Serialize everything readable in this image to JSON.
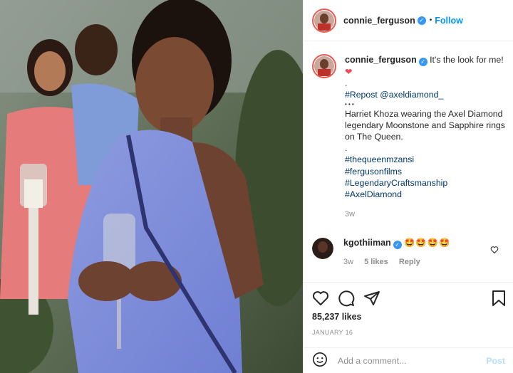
{
  "post": {
    "username": "connie_ferguson",
    "follow_label": "Follow",
    "separator": "•"
  },
  "caption": {
    "username": "connie_ferguson",
    "lines": {
      "l1": "It's the look for me!",
      "dot1": ".",
      "repost_tag": "#Repost",
      "repost_user": "@axeldiamond_",
      "bullets": "• • •",
      "body": "Harriet Khoza wearing the Axel Diamond legendary Moonstone and Sapphire rings on The Queen.",
      "dot2": ".",
      "tag1": "#thequeenmzansi",
      "tag2": "#fergusonfilms",
      "tag3": "#LegendaryCraftsmanship",
      "tag4": "#AxelDiamond"
    },
    "time": "3w"
  },
  "comments": [
    {
      "username": "kgothiiman",
      "text": "🤩🤩🤩🤩",
      "time": "3w",
      "likes": "5 likes",
      "reply": "Reply"
    }
  ],
  "likes": "85,237 likes",
  "date": "JANUARY 16",
  "add_comment": {
    "placeholder": "Add a comment...",
    "post_label": "Post"
  },
  "icons": {
    "verified": "verified-badge-icon",
    "heart": "heart-icon",
    "comment": "comment-icon",
    "share": "share-icon",
    "save": "bookmark-icon",
    "emoji": "emoji-icon"
  },
  "colors": {
    "link": "#0095f6",
    "hashtag": "#00376b",
    "verified": "#3897f0",
    "heart": "#ed4956",
    "muted": "#8e8e8e"
  }
}
